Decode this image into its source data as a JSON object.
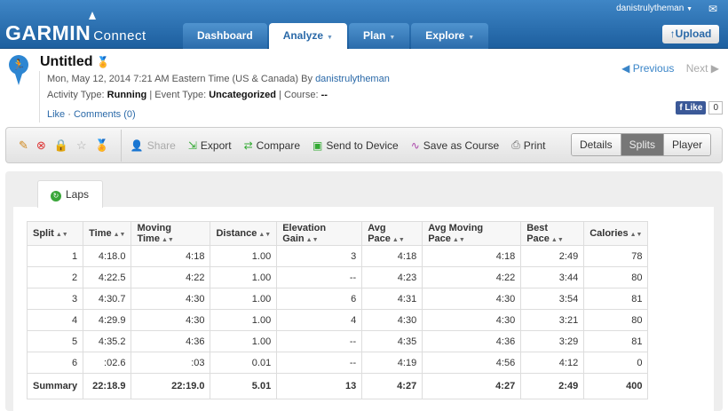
{
  "header": {
    "logo": "GARMIN",
    "logo_sub": "Connect",
    "username": "danistrulytheman",
    "upload": "Upload",
    "tabs": [
      {
        "label": "Dashboard",
        "dropdown": false
      },
      {
        "label": "Analyze",
        "dropdown": true
      },
      {
        "label": "Plan",
        "dropdown": true
      },
      {
        "label": "Explore",
        "dropdown": true
      }
    ]
  },
  "activity": {
    "title": "Untitled",
    "date": "Mon, May 12, 2014 7:21 AM Eastern Time (US & Canada)",
    "by_label": "By",
    "owner": "danistrulytheman",
    "type_label": "Activity Type:",
    "type": "Running",
    "event_label": "Event Type:",
    "event": "Uncategorized",
    "course_label": "Course:",
    "course": "--",
    "like": "Like",
    "comments": "Comments (0)",
    "previous": "Previous",
    "next": "Next",
    "fb_like": "Like",
    "fb_count": "0"
  },
  "toolbar": {
    "share": "Share",
    "export": "Export",
    "compare": "Compare",
    "send": "Send to Device",
    "save_course": "Save as Course",
    "print": "Print",
    "views": [
      "Details",
      "Splits",
      "Player"
    ],
    "active_view": "Splits"
  },
  "laps_tab": "Laps",
  "table": {
    "headers": [
      "Split",
      "Time",
      "Moving Time",
      "Distance",
      "Elevation Gain",
      "Avg Pace",
      "Avg Moving Pace",
      "Best Pace",
      "Calories"
    ],
    "rows": [
      [
        "1",
        "4:18.0",
        "4:18",
        "1.00",
        "3",
        "4:18",
        "4:18",
        "2:49",
        "78"
      ],
      [
        "2",
        "4:22.5",
        "4:22",
        "1.00",
        "--",
        "4:23",
        "4:22",
        "3:44",
        "80"
      ],
      [
        "3",
        "4:30.7",
        "4:30",
        "1.00",
        "6",
        "4:31",
        "4:30",
        "3:54",
        "81"
      ],
      [
        "4",
        "4:29.9",
        "4:30",
        "1.00",
        "4",
        "4:30",
        "4:30",
        "3:21",
        "80"
      ],
      [
        "5",
        "4:35.2",
        "4:36",
        "1.00",
        "--",
        "4:35",
        "4:36",
        "3:29",
        "81"
      ],
      [
        "6",
        ":02.6",
        ":03",
        "0.01",
        "--",
        "4:19",
        "4:56",
        "4:12",
        "0"
      ]
    ],
    "summary": [
      "Summary",
      "22:18.9",
      "22:19.0",
      "5.01",
      "13",
      "4:27",
      "4:27",
      "2:49",
      "400"
    ]
  }
}
